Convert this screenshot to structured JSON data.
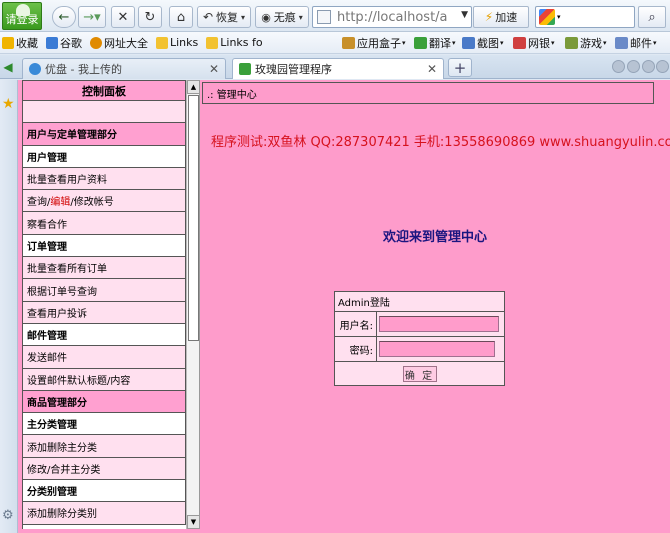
{
  "browser": {
    "login_label": "请登录",
    "restore_label": "恢复",
    "incognito_label": "无痕",
    "address_url": "http://localhost/adn",
    "speed_label": "加速",
    "bookmarks": [
      {
        "label": "收藏",
        "color": "#f0b400"
      },
      {
        "label": "谷歌",
        "color": "#3a7bd5"
      },
      {
        "label": "网址大全",
        "color": "#e08a00"
      },
      {
        "label": "Links",
        "color": "#f2c230"
      },
      {
        "label": "Links fo",
        "color": "#f2c230"
      }
    ],
    "right_bookmarks": [
      {
        "label": "应用盒子",
        "color": "#c8902a"
      },
      {
        "label": "翻译",
        "color": "#3aa03a"
      },
      {
        "label": "截图",
        "color": "#4a7ac8"
      },
      {
        "label": "网银",
        "color": "#d04040"
      },
      {
        "label": "游戏",
        "color": "#7a9a3a"
      },
      {
        "label": "邮件",
        "color": "#6a8ac8"
      }
    ],
    "tabs": [
      {
        "title": "优盘 - 我上传的",
        "active": false,
        "icon_color": "#3a8ad8"
      },
      {
        "title": "玫瑰园管理程序",
        "active": true,
        "icon_color": "#3aa03a"
      }
    ]
  },
  "panel": {
    "title": "控制面板",
    "items": [
      {
        "label": "",
        "kind": "blank"
      },
      {
        "label": "用户与定单管理部分",
        "kind": "section"
      },
      {
        "label": "用户管理",
        "kind": "group"
      },
      {
        "label": "批量查看用户资料",
        "kind": "item"
      },
      {
        "label_prefix": "查询/",
        "label_highlight": "编辑",
        "label_suffix": "/修改帐号",
        "kind": "item-hl"
      },
      {
        "label": "察看合作",
        "kind": "item"
      },
      {
        "label": "订单管理",
        "kind": "group"
      },
      {
        "label": "批量查看所有订单",
        "kind": "item"
      },
      {
        "label": "根据订单号查询",
        "kind": "item"
      },
      {
        "label": "查看用户投诉",
        "kind": "item"
      },
      {
        "label": "邮件管理",
        "kind": "group"
      },
      {
        "label": "发送邮件",
        "kind": "item"
      },
      {
        "label": "设置邮件默认标题/内容",
        "kind": "item"
      },
      {
        "label": "商品管理部分",
        "kind": "section"
      },
      {
        "label": "主分类管理",
        "kind": "group"
      },
      {
        "label": "添加删除主分类",
        "kind": "item"
      },
      {
        "label": "修改/合并主分类",
        "kind": "item"
      },
      {
        "label": "分类别管理",
        "kind": "group"
      },
      {
        "label": "添加删除分类别",
        "kind": "item"
      }
    ]
  },
  "main": {
    "breadcrumb": ".: 管理中心",
    "tester_text": "程序测试:双鱼林 QQ:287307421 手机:13558690869 www.shuangyulin.com",
    "welcome": "欢迎来到管理中心",
    "login_box": {
      "heading": "Admin登陆",
      "username_label": "用户名:",
      "password_label": "密码:",
      "username_value": "",
      "password_value": "",
      "submit_label": "确 定"
    }
  },
  "colors": {
    "content_bg": "#fe9ccb",
    "panel_title_bg": "#ffa0d0",
    "menu_bg": "#ffe0ef",
    "tester_red": "#d6121e",
    "welcome_navy": "#1a1580"
  }
}
